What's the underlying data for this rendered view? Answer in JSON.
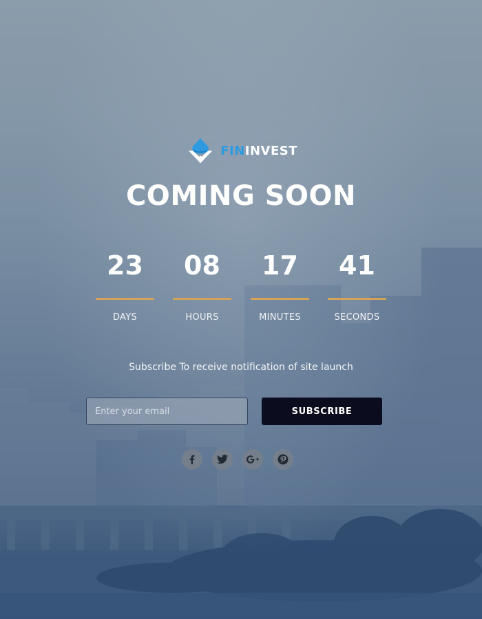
{
  "brand": {
    "name_part1": "FIN",
    "name_part2": "INVEST",
    "logo_icon": "diamond-drop-logo-icon",
    "colors": {
      "accent_blue": "#2e9be0",
      "countdown_bar": "#d4a258",
      "button_bg": "#0c0c1f"
    }
  },
  "title": "COMING SOON",
  "countdown": [
    {
      "value": "23",
      "label": "DAYS"
    },
    {
      "value": "08",
      "label": "HOURS"
    },
    {
      "value": "17",
      "label": "MINUTES"
    },
    {
      "value": "41",
      "label": "SECONDS"
    }
  ],
  "subscribe": {
    "text": "Subscribe To receive notification of site launch",
    "email_placeholder": "Enter your email",
    "email_value": "",
    "button_label": "SUBSCRIBE"
  },
  "socials": [
    {
      "icon": "facebook-icon"
    },
    {
      "icon": "twitter-icon"
    },
    {
      "icon": "google-plus-icon"
    },
    {
      "icon": "pinterest-icon"
    }
  ]
}
